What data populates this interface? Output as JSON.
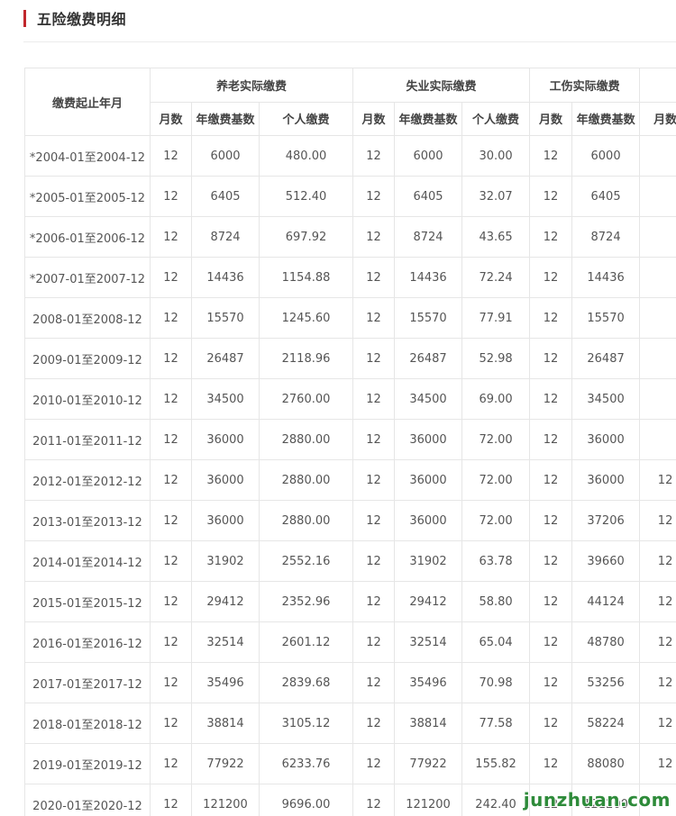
{
  "page_title": "五险缴费明细",
  "table": {
    "date_header": "缴费起止年月",
    "group_headers": {
      "pension": "养老实际缴费",
      "unemployment": "失业实际缴费",
      "injury": "工伤实际缴费"
    },
    "sub_headers": {
      "months": "月数",
      "base": "年缴费基数",
      "personal": "个人缴费"
    },
    "rows": [
      {
        "period": "*2004-01至2004-12",
        "p_months": "12",
        "p_base": "6000",
        "p_personal": "480.00",
        "u_months": "12",
        "u_base": "6000",
        "u_personal": "30.00",
        "i_months": "12",
        "i_base": "6000",
        "x_months": ""
      },
      {
        "period": "*2005-01至2005-12",
        "p_months": "12",
        "p_base": "6405",
        "p_personal": "512.40",
        "u_months": "12",
        "u_base": "6405",
        "u_personal": "32.07",
        "i_months": "12",
        "i_base": "6405",
        "x_months": ""
      },
      {
        "period": "*2006-01至2006-12",
        "p_months": "12",
        "p_base": "8724",
        "p_personal": "697.92",
        "u_months": "12",
        "u_base": "8724",
        "u_personal": "43.65",
        "i_months": "12",
        "i_base": "8724",
        "x_months": ""
      },
      {
        "period": "*2007-01至2007-12",
        "p_months": "12",
        "p_base": "14436",
        "p_personal": "1154.88",
        "u_months": "12",
        "u_base": "14436",
        "u_personal": "72.24",
        "i_months": "12",
        "i_base": "14436",
        "x_months": ""
      },
      {
        "period": "2008-01至2008-12",
        "p_months": "12",
        "p_base": "15570",
        "p_personal": "1245.60",
        "u_months": "12",
        "u_base": "15570",
        "u_personal": "77.91",
        "i_months": "12",
        "i_base": "15570",
        "x_months": ""
      },
      {
        "period": "2009-01至2009-12",
        "p_months": "12",
        "p_base": "26487",
        "p_personal": "2118.96",
        "u_months": "12",
        "u_base": "26487",
        "u_personal": "52.98",
        "i_months": "12",
        "i_base": "26487",
        "x_months": ""
      },
      {
        "period": "2010-01至2010-12",
        "p_months": "12",
        "p_base": "34500",
        "p_personal": "2760.00",
        "u_months": "12",
        "u_base": "34500",
        "u_personal": "69.00",
        "i_months": "12",
        "i_base": "34500",
        "x_months": ""
      },
      {
        "period": "2011-01至2011-12",
        "p_months": "12",
        "p_base": "36000",
        "p_personal": "2880.00",
        "u_months": "12",
        "u_base": "36000",
        "u_personal": "72.00",
        "i_months": "12",
        "i_base": "36000",
        "x_months": ""
      },
      {
        "period": "2012-01至2012-12",
        "p_months": "12",
        "p_base": "36000",
        "p_personal": "2880.00",
        "u_months": "12",
        "u_base": "36000",
        "u_personal": "72.00",
        "i_months": "12",
        "i_base": "36000",
        "x_months": "12"
      },
      {
        "period": "2013-01至2013-12",
        "p_months": "12",
        "p_base": "36000",
        "p_personal": "2880.00",
        "u_months": "12",
        "u_base": "36000",
        "u_personal": "72.00",
        "i_months": "12",
        "i_base": "37206",
        "x_months": "12"
      },
      {
        "period": "2014-01至2014-12",
        "p_months": "12",
        "p_base": "31902",
        "p_personal": "2552.16",
        "u_months": "12",
        "u_base": "31902",
        "u_personal": "63.78",
        "i_months": "12",
        "i_base": "39660",
        "x_months": "12"
      },
      {
        "period": "2015-01至2015-12",
        "p_months": "12",
        "p_base": "29412",
        "p_personal": "2352.96",
        "u_months": "12",
        "u_base": "29412",
        "u_personal": "58.80",
        "i_months": "12",
        "i_base": "44124",
        "x_months": "12"
      },
      {
        "period": "2016-01至2016-12",
        "p_months": "12",
        "p_base": "32514",
        "p_personal": "2601.12",
        "u_months": "12",
        "u_base": "32514",
        "u_personal": "65.04",
        "i_months": "12",
        "i_base": "48780",
        "x_months": "12"
      },
      {
        "period": "2017-01至2017-12",
        "p_months": "12",
        "p_base": "35496",
        "p_personal": "2839.68",
        "u_months": "12",
        "u_base": "35496",
        "u_personal": "70.98",
        "i_months": "12",
        "i_base": "53256",
        "x_months": "12"
      },
      {
        "period": "2018-01至2018-12",
        "p_months": "12",
        "p_base": "38814",
        "p_personal": "3105.12",
        "u_months": "12",
        "u_base": "38814",
        "u_personal": "77.58",
        "i_months": "12",
        "i_base": "58224",
        "x_months": "12"
      },
      {
        "period": "2019-01至2019-12",
        "p_months": "12",
        "p_base": "77922",
        "p_personal": "6233.76",
        "u_months": "12",
        "u_base": "77922",
        "u_personal": "155.82",
        "i_months": "12",
        "i_base": "88080",
        "x_months": "12"
      },
      {
        "period": "2020-01至2020-12",
        "p_months": "12",
        "p_base": "121200",
        "p_personal": "9696.00",
        "u_months": "12",
        "u_base": "121200",
        "u_personal": "242.40",
        "i_months": "12",
        "i_base": "121200",
        "x_months": ""
      }
    ]
  },
  "watermark": "junzhuan.com"
}
